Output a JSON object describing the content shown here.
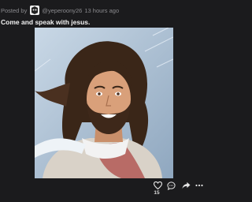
{
  "post": {
    "posted_by_label": "Posted by",
    "username": "@yeperoony26",
    "timestamp": "13 hours ago",
    "title": "Come and speak with jesus.",
    "image": {
      "icon": "jesus-portrait-illustration"
    }
  },
  "actions": {
    "like": {
      "icon": "heart-icon",
      "count": "15"
    },
    "comment": {
      "icon": "comment-icon"
    },
    "share": {
      "icon": "share-icon"
    },
    "more": {
      "icon": "more-icon"
    }
  },
  "colors": {
    "background": "#1b1b1d",
    "text": "#f2f2f2",
    "muted": "#8a8a8e"
  }
}
